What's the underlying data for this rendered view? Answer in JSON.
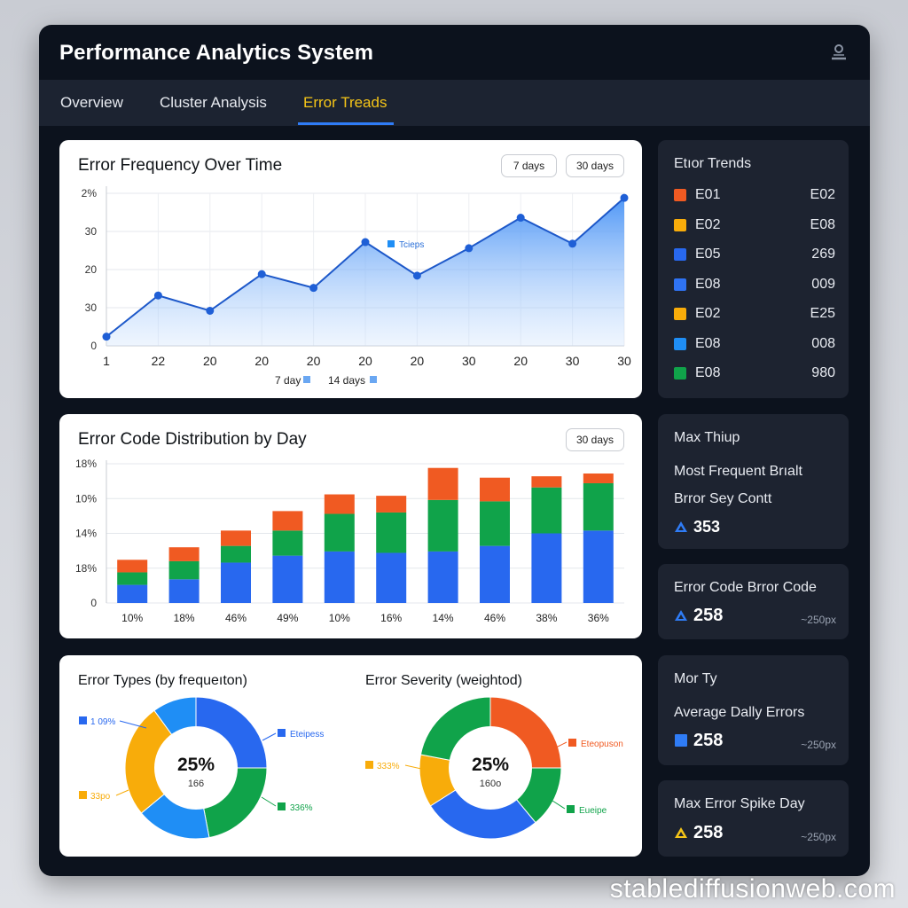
{
  "app": {
    "title": "Performance Analytics System",
    "watermark": "stablediffusionweb.com"
  },
  "tabs": [
    {
      "label": "Overview",
      "active": false
    },
    {
      "label": "Cluster Analysis",
      "active": false
    },
    {
      "label": "Error Treads",
      "active": true
    }
  ],
  "colors": {
    "accent": "#2f7cf6",
    "active_tab": "#f5c518",
    "orange": "#f05a22",
    "yellow": "#f8ac0a",
    "blue": "#2868ef",
    "sky": "#1f8ef5",
    "green": "#10a34a"
  },
  "freq_card": {
    "title": "Error Frequency Over Time",
    "buttons": [
      "7 days",
      "30 days"
    ],
    "legend": [
      "7 day",
      "14 days"
    ],
    "annotation": "Tcieps"
  },
  "dist_card": {
    "title": "Error Code Distribution by Day",
    "buttons": [
      "30 days"
    ]
  },
  "donut_card": {
    "left_title": "Error Types (by frequeıton)",
    "right_title": "Error Severity (weightod)",
    "left_center_big": "25%",
    "left_center_small": "166",
    "right_center_big": "25%",
    "right_center_small": "160o",
    "left_labels": [
      "1 09%",
      "Eteipess",
      "336%",
      "33po"
    ],
    "right_labels": [
      "Eteopuson",
      "Eueipe",
      "333%"
    ]
  },
  "trends_panel": {
    "title": "Etıor Trends",
    "items": [
      {
        "code": "E01",
        "value": "E02",
        "color": "#f05a22"
      },
      {
        "code": "E02",
        "value": "E08",
        "color": "#f8ac0a"
      },
      {
        "code": "E05",
        "value": "269",
        "color": "#2868ef"
      },
      {
        "code": "E08",
        "value": "009",
        "color": "#2f73f3"
      },
      {
        "code": "E02",
        "value": "E25",
        "color": "#f8ac0a"
      },
      {
        "code": "E08",
        "value": "008",
        "color": "#1f8ef5"
      },
      {
        "code": "E08",
        "value": "980",
        "color": "#10a34a"
      }
    ]
  },
  "max_panel": {
    "title": "Max Thiup",
    "line1": "Most Frequent Brıalt",
    "line2": "Brror Sey Contt",
    "value": "353",
    "icon": "triangle-icon"
  },
  "code_panel": {
    "line1": "Error Code Brror Code",
    "value": "258",
    "sub": "~250px",
    "icon": "triangle-icon"
  },
  "avg_panel": {
    "title": "Mor Ty",
    "line1": "Average Dally Errors",
    "value": "258",
    "sub": "~250px",
    "icon": "square-icon"
  },
  "spike_panel": {
    "line1": "Max Error Spike Day",
    "value": "258",
    "sub": "~250px",
    "icon": "triangle-icon"
  },
  "chart_data": [
    {
      "type": "area",
      "title": "Error Frequency Over Time",
      "y_tick_labels": [
        "0",
        "30",
        "20",
        "30",
        "2%"
      ],
      "x_tick_labels": [
        "1",
        "22",
        "20",
        "20",
        "20",
        "20",
        "20",
        "30",
        "20",
        "30",
        "30"
      ],
      "y_fraction_of_axis": [
        0.06,
        0.33,
        0.23,
        0.47,
        0.38,
        0.68,
        0.46,
        0.64,
        0.84,
        0.67,
        0.97
      ],
      "legend": [
        "7 day",
        "14 days"
      ],
      "grid": true
    },
    {
      "type": "bar",
      "stacked": true,
      "title": "Error Code Distribution by Day",
      "y_tick_labels": [
        "0",
        "18%",
        "14%",
        "10%",
        "18%"
      ],
      "categories": [
        "10%",
        "18%",
        "46%",
        "49%",
        "10%",
        "16%",
        "14%",
        "46%",
        "38%",
        "36%"
      ],
      "series": [
        {
          "color": "#2868ef",
          "values": [
            0.13,
            0.17,
            0.29,
            0.34,
            0.37,
            0.36,
            0.37,
            0.41,
            0.5,
            0.52
          ]
        },
        {
          "color": "#10a34a",
          "values": [
            0.09,
            0.13,
            0.12,
            0.18,
            0.27,
            0.29,
            0.37,
            0.32,
            0.33,
            0.34
          ]
        },
        {
          "color": "#f05a22",
          "values": [
            0.09,
            0.1,
            0.11,
            0.14,
            0.14,
            0.12,
            0.23,
            0.17,
            0.08,
            0.07
          ]
        }
      ],
      "grid": true
    },
    {
      "type": "pie",
      "title": "Error Types (by frequeıton)",
      "slices": [
        {
          "value": 25,
          "color": "#2868ef"
        },
        {
          "value": 22,
          "color": "#10a34a"
        },
        {
          "value": 17,
          "color": "#1f8ef5"
        },
        {
          "value": 26,
          "color": "#f8ac0a"
        },
        {
          "value": 10,
          "color": "#1f8ef5"
        }
      ]
    },
    {
      "type": "pie",
      "title": "Error Severity (weightod)",
      "slices": [
        {
          "value": 25,
          "color": "#f05a22"
        },
        {
          "value": 14,
          "color": "#10a34a"
        },
        {
          "value": 27,
          "color": "#2868ef"
        },
        {
          "value": 12,
          "color": "#f8ac0a"
        },
        {
          "value": 22,
          "color": "#10a34a"
        }
      ]
    }
  ]
}
